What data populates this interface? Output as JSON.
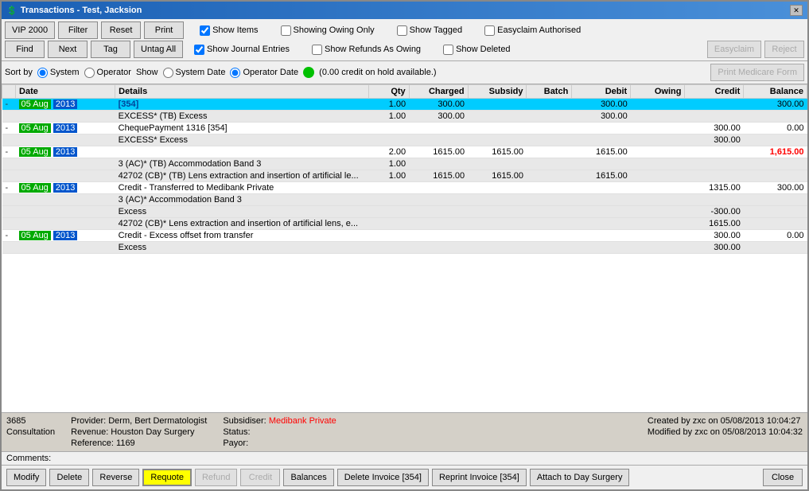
{
  "window": {
    "title": "Transactions - Test, Jacksion",
    "icon": "💲"
  },
  "toolbar": {
    "btn_vip2000": "VIP 2000",
    "btn_filter": "Filter",
    "btn_reset": "Reset",
    "btn_print": "Print",
    "btn_find": "Find",
    "btn_next": "Next",
    "btn_tag": "Tag",
    "btn_untag_all": "Untag All",
    "chk_show_items_label": "Show Items",
    "chk_show_items_checked": true,
    "chk_show_journal_label": "Show Journal Entries",
    "chk_show_journal_checked": true,
    "chk_showing_owing_label": "Showing Owing Only",
    "chk_showing_owing_checked": false,
    "chk_refunds_owing_label": "Show Refunds As Owing",
    "chk_refunds_owing_checked": false,
    "chk_show_tagged_label": "Show Tagged",
    "chk_show_tagged_checked": false,
    "chk_show_deleted_label": "Show Deleted",
    "chk_show_deleted_checked": false,
    "chk_easyclaim_label": "Easyclaim Authorised",
    "chk_easyclaim_checked": false,
    "btn_easyclaim": "Easyclaim",
    "btn_reject": "Reject",
    "btn_print_medicare": "Print Medicare Form"
  },
  "sort_bar": {
    "sort_by_label": "Sort by",
    "radio_system_label": "System",
    "radio_operator_label": "Operator",
    "show_label": "Show",
    "radio_system_date_label": "System Date",
    "radio_operator_date_label": "Operator Date",
    "credit_info": "(0.00 credit on hold available.)"
  },
  "table": {
    "headers": [
      "Date",
      "Details",
      "Qty",
      "Charged",
      "Subsidy",
      "Batch",
      "Debit",
      "Owing",
      "Credit",
      "Balance"
    ],
    "rows": [
      {
        "type": "main-highlight",
        "minus": "-",
        "date": "05 Aug",
        "year": "2013",
        "details": "[354]",
        "qty": "1.00",
        "charged": "300.00",
        "subsidy": "",
        "batch": "",
        "debit": "300.00",
        "owing": "",
        "credit": "",
        "balance": "300.00"
      },
      {
        "type": "sub",
        "minus": "",
        "date": "",
        "year": "",
        "details": "EXCESS* (TB) Excess",
        "qty": "1.00",
        "charged": "300.00",
        "subsidy": "",
        "batch": "",
        "debit": "300.00",
        "owing": "",
        "credit": "",
        "balance": ""
      },
      {
        "type": "main",
        "minus": "-",
        "date": "05 Aug",
        "year": "2013",
        "details": "ChequePayment  1316  [354]",
        "qty": "",
        "charged": "",
        "subsidy": "",
        "batch": "",
        "debit": "",
        "owing": "",
        "credit": "300.00",
        "balance": "0.00"
      },
      {
        "type": "sub",
        "minus": "",
        "date": "",
        "year": "",
        "details": "EXCESS* Excess",
        "qty": "",
        "charged": "",
        "subsidy": "",
        "batch": "",
        "debit": "",
        "owing": "",
        "credit": "300.00",
        "balance": ""
      },
      {
        "type": "main",
        "minus": "-",
        "date": "05 Aug",
        "year": "2013",
        "details": "",
        "qty": "2.00",
        "charged": "1615.00",
        "subsidy": "1615.00",
        "batch": "",
        "debit": "1615.00",
        "owing": "",
        "credit": "",
        "balance_red": "1,615.00"
      },
      {
        "type": "sub",
        "details": "3 (AC)* (TB) Accommodation Band 3",
        "qty": "1.00",
        "charged": "",
        "subsidy": "",
        "batch": "",
        "debit": "",
        "owing": "",
        "credit": "",
        "balance": ""
      },
      {
        "type": "sub",
        "details": "42702 (CB)* (TB) Lens extraction and insertion of artificial le...",
        "qty": "1.00",
        "charged": "1615.00",
        "subsidy": "1615.00",
        "batch": "",
        "debit": "1615.00",
        "owing": "",
        "credit": "",
        "balance": ""
      },
      {
        "type": "main",
        "minus": "-",
        "date": "05 Aug",
        "year": "2013",
        "details": "Credit - Transferred to Medibank Private",
        "qty": "",
        "charged": "",
        "subsidy": "",
        "batch": "",
        "debit": "",
        "owing": "",
        "credit": "1315.00",
        "balance": "300.00"
      },
      {
        "type": "sub",
        "details": "3 (AC)* Accommodation Band 3",
        "qty": "",
        "charged": "",
        "subsidy": "",
        "batch": "",
        "debit": "",
        "owing": "",
        "credit": "",
        "balance": ""
      },
      {
        "type": "sub",
        "details": "Excess",
        "qty": "",
        "charged": "",
        "subsidy": "",
        "batch": "",
        "debit": "",
        "owing": "",
        "credit": "-300.00",
        "balance": ""
      },
      {
        "type": "sub",
        "details": "42702 (CB)* Lens extraction and insertion of artificial lens, e...",
        "qty": "",
        "charged": "",
        "subsidy": "",
        "batch": "",
        "debit": "",
        "owing": "",
        "credit": "1615.00",
        "balance": ""
      },
      {
        "type": "main",
        "minus": "-",
        "date": "05 Aug",
        "year": "2013",
        "details": "Credit - Excess offset from transfer",
        "qty": "",
        "charged": "",
        "subsidy": "",
        "batch": "",
        "debit": "",
        "owing": "",
        "credit": "300.00",
        "balance": "0.00"
      },
      {
        "type": "sub",
        "details": "Excess",
        "qty": "",
        "charged": "",
        "subsidy": "",
        "batch": "",
        "debit": "",
        "owing": "",
        "credit": "300.00",
        "balance": ""
      }
    ]
  },
  "status_bar": {
    "id": "3685",
    "type": "Consultation",
    "provider": "Provider: Derm, Bert  Dermatologist",
    "revenue": "Revenue: Houston Day Surgery",
    "reference": "Reference: 1169",
    "subsidiser_label": "Subsidiser:",
    "subsidiser_value": "Medibank Private",
    "status_label": "Status:",
    "status_value": "",
    "payor_label": "Payor:",
    "payor_value": "",
    "created": "Created by zxc on 05/08/2013 10:04:27",
    "modified": "Modified by zxc on 05/08/2013 10:04:32"
  },
  "comments": {
    "label": "Comments:"
  },
  "bottom_buttons": {
    "modify": "Modify",
    "delete": "Delete",
    "reverse": "Reverse",
    "requote": "Requote",
    "refund": "Refund",
    "credit": "Credit",
    "balances": "Balances",
    "delete_invoice": "Delete Invoice [354]",
    "reprint_invoice": "Reprint Invoice [354]",
    "attach": "Attach to Day Surgery",
    "close": "Close"
  }
}
